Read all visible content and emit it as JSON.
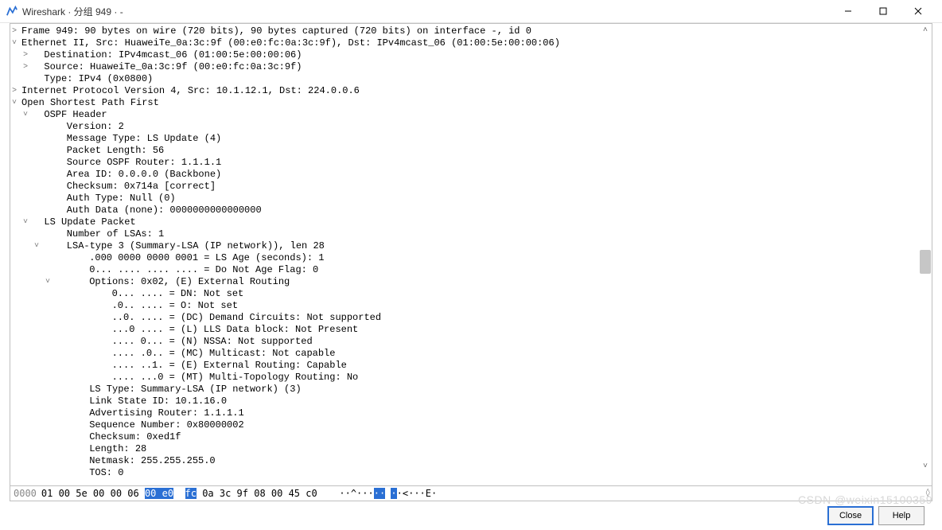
{
  "title": "Wireshark · 分组 949 · -",
  "watermark": "CSDN @weixin15100359",
  "buttons": {
    "close": "Close",
    "help": "Help"
  },
  "tree": [
    {
      "d": 0,
      "a": ">",
      "t": "Frame 949: 90 bytes on wire (720 bits), 90 bytes captured (720 bits) on interface -, id 0"
    },
    {
      "d": 0,
      "a": "v",
      "t": "Ethernet II, Src: HuaweiTe_0a:3c:9f (00:e0:fc:0a:3c:9f), Dst: IPv4mcast_06 (01:00:5e:00:00:06)"
    },
    {
      "d": 1,
      "a": ">",
      "t": "Destination: IPv4mcast_06 (01:00:5e:00:00:06)"
    },
    {
      "d": 1,
      "a": ">",
      "t": "Source: HuaweiTe_0a:3c:9f (00:e0:fc:0a:3c:9f)"
    },
    {
      "d": 1,
      "a": "",
      "t": "Type: IPv4 (0x0800)"
    },
    {
      "d": 0,
      "a": ">",
      "t": "Internet Protocol Version 4, Src: 10.1.12.1, Dst: 224.0.0.6"
    },
    {
      "d": 0,
      "a": "v",
      "t": "Open Shortest Path First"
    },
    {
      "d": 1,
      "a": "v",
      "t": "OSPF Header"
    },
    {
      "d": 2,
      "a": "",
      "t": "Version: 2"
    },
    {
      "d": 2,
      "a": "",
      "t": "Message Type: LS Update (4)"
    },
    {
      "d": 2,
      "a": "",
      "t": "Packet Length: 56"
    },
    {
      "d": 2,
      "a": "",
      "t": "Source OSPF Router: 1.1.1.1"
    },
    {
      "d": 2,
      "a": "",
      "t": "Area ID: 0.0.0.0 (Backbone)"
    },
    {
      "d": 2,
      "a": "",
      "t": "Checksum: 0x714a [correct]"
    },
    {
      "d": 2,
      "a": "",
      "t": "Auth Type: Null (0)"
    },
    {
      "d": 2,
      "a": "",
      "t": "Auth Data (none): 0000000000000000"
    },
    {
      "d": 1,
      "a": "v",
      "t": "LS Update Packet"
    },
    {
      "d": 2,
      "a": "",
      "t": "Number of LSAs: 1"
    },
    {
      "d": 2,
      "a": "v",
      "t": "LSA-type 3 (Summary-LSA (IP network)), len 28"
    },
    {
      "d": 3,
      "a": "",
      "t": ".000 0000 0000 0001 = LS Age (seconds): 1"
    },
    {
      "d": 3,
      "a": "",
      "t": "0... .... .... .... = Do Not Age Flag: 0"
    },
    {
      "d": 3,
      "a": "v",
      "t": "Options: 0x02, (E) External Routing"
    },
    {
      "d": 4,
      "a": "",
      "t": "0... .... = DN: Not set"
    },
    {
      "d": 4,
      "a": "",
      "t": ".0.. .... = O: Not set"
    },
    {
      "d": 4,
      "a": "",
      "t": "..0. .... = (DC) Demand Circuits: Not supported"
    },
    {
      "d": 4,
      "a": "",
      "t": "...0 .... = (L) LLS Data block: Not Present"
    },
    {
      "d": 4,
      "a": "",
      "t": ".... 0... = (N) NSSA: Not supported"
    },
    {
      "d": 4,
      "a": "",
      "t": ".... .0.. = (MC) Multicast: Not capable"
    },
    {
      "d": 4,
      "a": "",
      "t": ".... ..1. = (E) External Routing: Capable"
    },
    {
      "d": 4,
      "a": "",
      "t": ".... ...0 = (MT) Multi-Topology Routing: No"
    },
    {
      "d": 3,
      "a": "",
      "t": "LS Type: Summary-LSA (IP network) (3)"
    },
    {
      "d": 3,
      "a": "",
      "t": "Link State ID: 10.1.16.0"
    },
    {
      "d": 3,
      "a": "",
      "t": "Advertising Router: 1.1.1.1"
    },
    {
      "d": 3,
      "a": "",
      "t": "Sequence Number: 0x80000002"
    },
    {
      "d": 3,
      "a": "",
      "t": "Checksum: 0xed1f"
    },
    {
      "d": 3,
      "a": "",
      "t": "Length: 28"
    },
    {
      "d": 3,
      "a": "",
      "t": "Netmask: 255.255.255.0"
    },
    {
      "d": 3,
      "a": "",
      "t": "TOS: 0"
    }
  ],
  "hex": {
    "offset": "0000",
    "bytes_before": "01 00 5e 00 00 06 ",
    "bytes_sel1": "00 e0",
    "bytes_mid": "  ",
    "bytes_sel2": "fc",
    "bytes_after": " 0a 3c 9f 08 00 45 c0",
    "ascii_before": "   ··^···",
    "ascii_sel": "··",
    "ascii_mid": " ",
    "ascii_sel2": "·",
    "ascii_after": "·<···E·"
  }
}
